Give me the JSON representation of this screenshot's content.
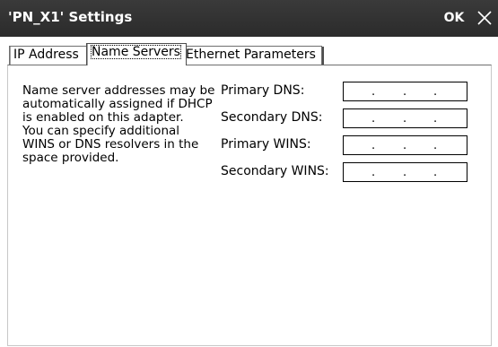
{
  "window": {
    "title": "'PN_X1' Settings",
    "ok_label": "OK",
    "close_icon": "close-icon"
  },
  "tabs": [
    {
      "label": "IP Address",
      "active": false
    },
    {
      "label": "Name Servers",
      "active": true
    },
    {
      "label": "Ethernet Parameters",
      "active": false
    }
  ],
  "description": {
    "lines": [
      "Name server addresses may be",
      "automatically assigned if DHCP",
      "is enabled on this adapter.",
      "You can specify additional",
      "WINS or DNS resolvers in the",
      "space provided."
    ]
  },
  "fields": [
    {
      "label": "Primary DNS:",
      "value": "",
      "separator": "."
    },
    {
      "label": "Secondary DNS:",
      "value": "",
      "separator": "."
    },
    {
      "label": "Primary WINS:",
      "value": "",
      "separator": "."
    },
    {
      "label": "Secondary WINS:",
      "value": "",
      "separator": "."
    }
  ],
  "colors": {
    "titlebar": "#2f2f2f",
    "titletext": "#ffffff",
    "background": "#ffffff"
  }
}
